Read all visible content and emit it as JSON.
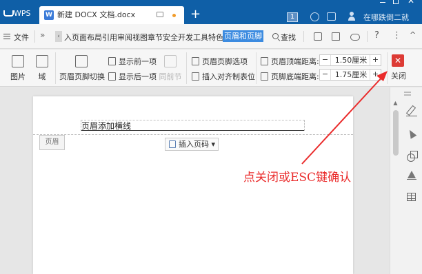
{
  "titlebar": {
    "app_tab": "WPS",
    "doc_tab_title": "新建 DOCX 文档.docx",
    "new_tab": "+",
    "badge": "1",
    "user_text": "在哪跌倒二就",
    "min": "",
    "max": "",
    "close": "✕"
  },
  "menubar": {
    "file": "文件",
    "more": "»",
    "left_arrow": "‹",
    "items": "入页面布局引用审阅视图章节安全开发工具特色应用",
    "active_tab": "页眉和页脚",
    "search": "查找",
    "help": "?",
    "more_menu": "⋮",
    "collapse": "^"
  },
  "ribbon": {
    "picture": "图片",
    "field": "域",
    "header_footer_switch": "页眉页脚切换",
    "show_prev": "显示前一项",
    "show_next": "显示后一项",
    "same_as_prev": "同前节",
    "header_footer_options": "页眉页脚选项",
    "insert_align_tab": "插入对齐制表位",
    "header_top_label": "页眉顶端距离:",
    "header_top_value": "1.50厘米",
    "footer_bottom_label": "页脚底端距离:",
    "footer_bottom_value": "1.75厘米",
    "minus": "−",
    "plus": "+",
    "close_label": "关闭",
    "close_glyph": "✕"
  },
  "document": {
    "header_text": "页眉添加横线",
    "header_tag": "页眉",
    "insert_page_number": "插入页码 ▾"
  },
  "annotation": {
    "text": "点关闭或ESC键确认",
    "color": "#ea2b2b"
  },
  "colors": {
    "titlebar": "#0f5fa7",
    "active_tab": "#3c8be0",
    "close_button": "#dd3b35"
  }
}
